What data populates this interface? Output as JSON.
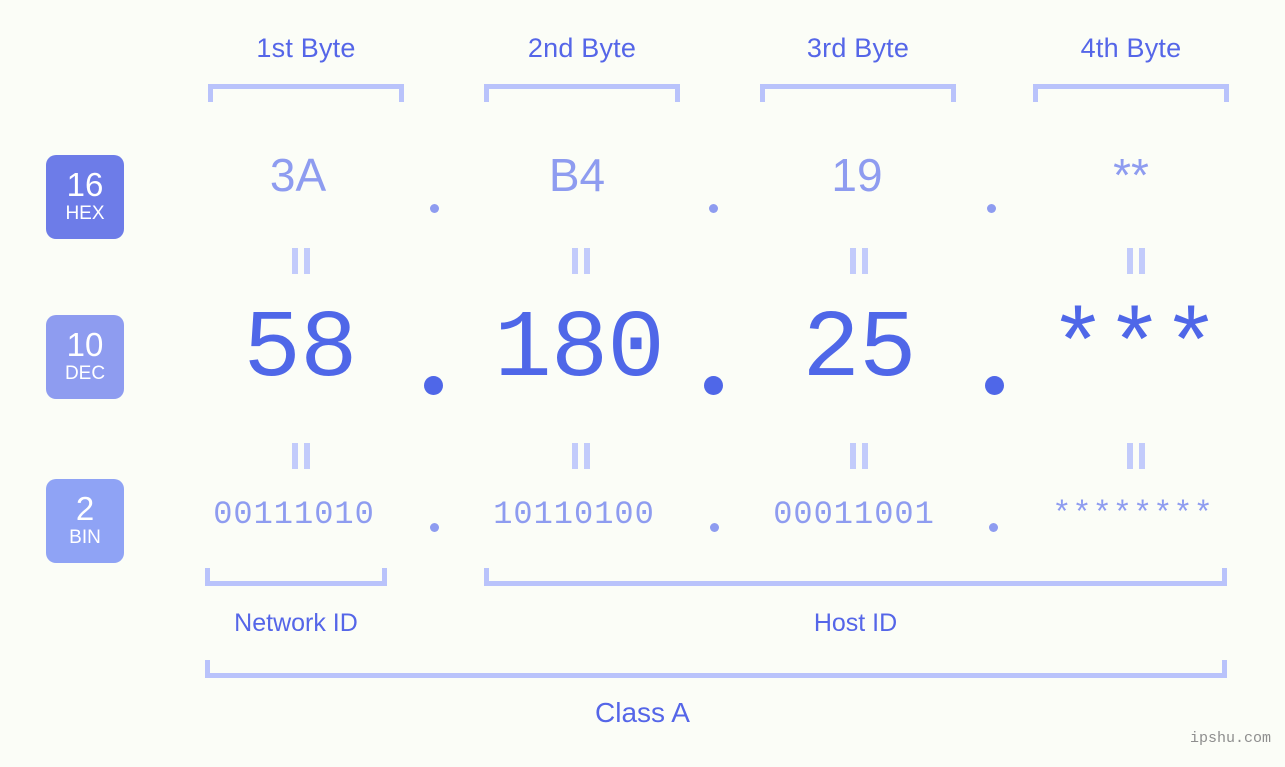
{
  "page": {
    "background_color": "#fbfdf7",
    "accent_color": "#5566e8",
    "accent_light_color": "#8e9cf0",
    "bracket_color": "#b9c3fb",
    "watermark": "ipshu.com"
  },
  "byte_headers": [
    {
      "label": "1st Byte"
    },
    {
      "label": "2nd Byte"
    },
    {
      "label": "3rd Byte"
    },
    {
      "label": "4th Byte"
    }
  ],
  "radix_badges": [
    {
      "number": "16",
      "name": "HEX",
      "color": "#6d7ce8"
    },
    {
      "number": "10",
      "name": "DEC",
      "color": "#8e9cf0"
    },
    {
      "number": "2",
      "name": "BIN",
      "color": "#8fa3f5"
    }
  ],
  "rows": {
    "hex": {
      "base": "16",
      "label": "HEX",
      "octets": [
        "3A",
        "B4",
        "19",
        "**"
      ],
      "separator": "."
    },
    "dec": {
      "base": "10",
      "label": "DEC",
      "octets": [
        "58",
        "180",
        "25",
        "***"
      ],
      "separator": "."
    },
    "bin": {
      "base": "2",
      "label": "BIN",
      "octets": [
        "00111010",
        "10110100",
        "00011001",
        "********"
      ],
      "separator": "."
    }
  },
  "equals_marks": {
    "symbol": "||",
    "count_per_row": 4
  },
  "id_labels": {
    "network": "Network ID",
    "host": "Host ID"
  },
  "class_label": "Class A"
}
